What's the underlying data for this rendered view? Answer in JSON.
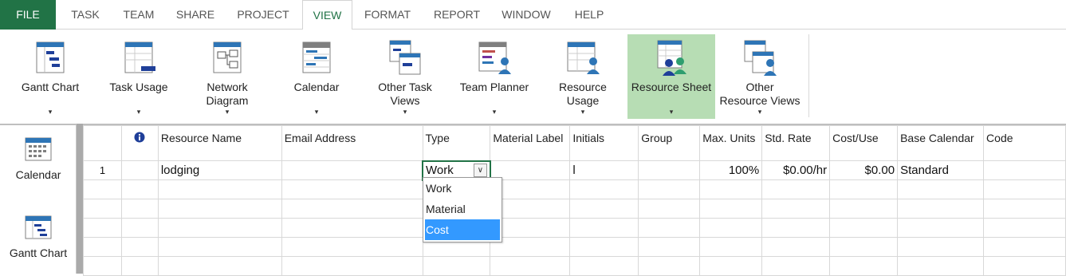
{
  "menu_tabs": [
    "FILE",
    "TASK",
    "TEAM",
    "SHARE",
    "PROJECT",
    "VIEW",
    "FORMAT",
    "REPORT",
    "WINDOW",
    "HELP"
  ],
  "active_tab": "VIEW",
  "ribbon": {
    "buttons": [
      {
        "label": "Gantt Chart",
        "icon": "gantt-chart-icon"
      },
      {
        "label": "Task Usage",
        "icon": "task-usage-icon"
      },
      {
        "label": "Network\nDiagram",
        "icon": "network-diagram-icon"
      },
      {
        "label": "Calendar",
        "icon": "calendar-icon"
      },
      {
        "label": "Other Task\nViews",
        "icon": "other-task-views-icon"
      },
      {
        "label": "Team Planner",
        "icon": "team-planner-icon"
      },
      {
        "label": "Resource\nUsage",
        "icon": "resource-usage-icon"
      },
      {
        "label": "Resource Sheet",
        "icon": "resource-sheet-icon"
      },
      {
        "label": "Other\nResource Views",
        "icon": "other-resource-views-icon"
      }
    ],
    "selected": "Resource Sheet",
    "arrow": "▾"
  },
  "view_bar": {
    "items": [
      {
        "label": "Calendar",
        "icon": "calendar-icon"
      },
      {
        "label": "Gantt Chart",
        "icon": "gantt-chart-icon"
      }
    ]
  },
  "sheet": {
    "indicator_icon": "info-icon",
    "columns": [
      "Resource Name",
      "Email Address",
      "Type",
      "Material Label",
      "Initials",
      "Group",
      "Max. Units",
      "Std. Rate",
      "Cost/Use",
      "Base Calendar",
      "Code"
    ],
    "rows": [
      {
        "id": "1",
        "resource_name": "lodging",
        "email": "",
        "type": "Work",
        "material_label": "",
        "initials": "l",
        "group": "",
        "max_units": "100%",
        "std_rate": "$0.00/hr",
        "cost_use": "$0.00",
        "base_calendar": "Standard",
        "code": ""
      }
    ],
    "type_dropdown": {
      "options": [
        "Work",
        "Material",
        "Cost"
      ],
      "highlighted": "Cost"
    }
  },
  "colors": {
    "file_tab": "#217346",
    "accent_green": "#217346",
    "selected_button": "#b7ddb4",
    "dropdown_highlight": "#3399ff"
  }
}
